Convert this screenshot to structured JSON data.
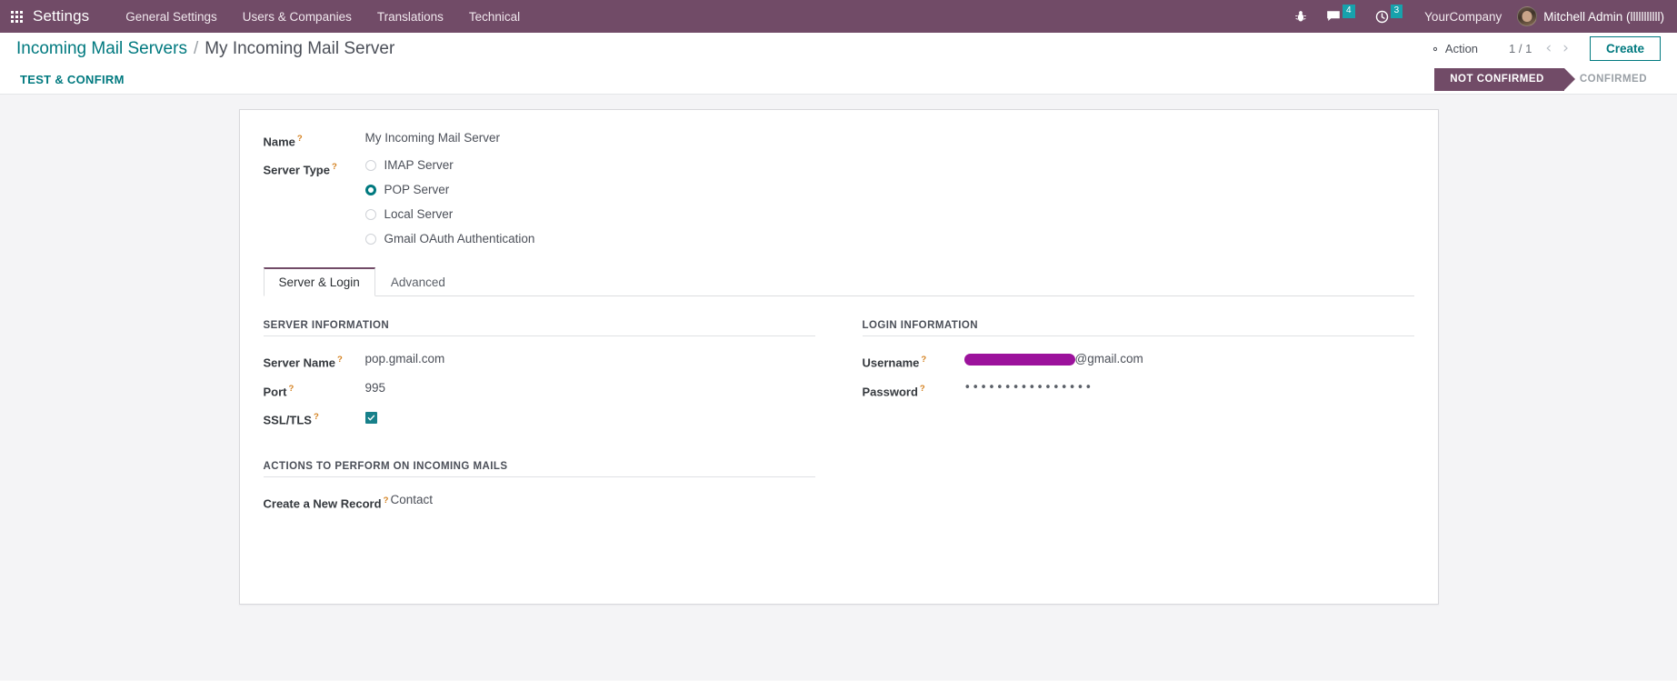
{
  "navbar": {
    "apps_icon": "apps-grid-icon",
    "brand": "Settings",
    "menu": [
      {
        "label": "General Settings"
      },
      {
        "label": "Users & Companies"
      },
      {
        "label": "Translations"
      },
      {
        "label": "Technical"
      }
    ],
    "debug_icon": "bug-icon",
    "messages": {
      "icon": "chat-bubble-icon",
      "count": "4"
    },
    "activities": {
      "icon": "clock-icon",
      "count": "3"
    },
    "company": "YourCompany",
    "user": "Mitchell Admin (lllllllllll)",
    "avatar_icon": "user-avatar"
  },
  "control_panel": {
    "breadcrumb_root": "Incoming Mail Servers",
    "breadcrumb_sep": "/",
    "breadcrumb_current": "My Incoming Mail Server",
    "action_label": "Action",
    "action_icon": "gear-icon",
    "pager": "1 / 1",
    "prev_icon": "chevron-left-icon",
    "next_icon": "chevron-right-icon",
    "prev_glyph": "‹",
    "next_glyph": "›",
    "create_label": "Create"
  },
  "statusbar": {
    "test_confirm_label": "TEST & CONFIRM",
    "steps": [
      {
        "label": "NOT CONFIRMED",
        "active": true
      },
      {
        "label": "CONFIRMED",
        "active": false
      }
    ]
  },
  "form": {
    "help_mark": "?",
    "name": {
      "label": "Name",
      "value": "My Incoming Mail Server"
    },
    "server_type": {
      "label": "Server Type",
      "options": [
        {
          "label": "IMAP Server",
          "selected": false
        },
        {
          "label": "POP Server",
          "selected": true
        },
        {
          "label": "Local Server",
          "selected": false
        },
        {
          "label": "Gmail OAuth Authentication",
          "selected": false
        }
      ]
    },
    "tabs": [
      {
        "label": "Server & Login",
        "active": true
      },
      {
        "label": "Advanced",
        "active": false
      }
    ],
    "server_information": {
      "title": "SERVER INFORMATION",
      "server_name": {
        "label": "Server Name",
        "value": "pop.gmail.com"
      },
      "port": {
        "label": "Port",
        "value": "995"
      },
      "ssl_tls": {
        "label": "SSL/TLS",
        "checked": true
      }
    },
    "login_information": {
      "title": "LOGIN INFORMATION",
      "username": {
        "label": "Username",
        "redacted": true,
        "visible_suffix": "@gmail.com"
      },
      "password": {
        "label": "Password",
        "value": "••••••••••••••••"
      }
    },
    "actions_section": {
      "title": "ACTIONS TO PERFORM ON INCOMING MAILS",
      "create_new_record": {
        "label": "Create a New Record",
        "value": "Contact"
      }
    }
  },
  "colors": {
    "brand_purple": "#714B67",
    "accent_teal": "#00797f",
    "badge_teal": "#17a2ac",
    "help_orange": "#d4811f",
    "redaction": "#9c129c"
  }
}
